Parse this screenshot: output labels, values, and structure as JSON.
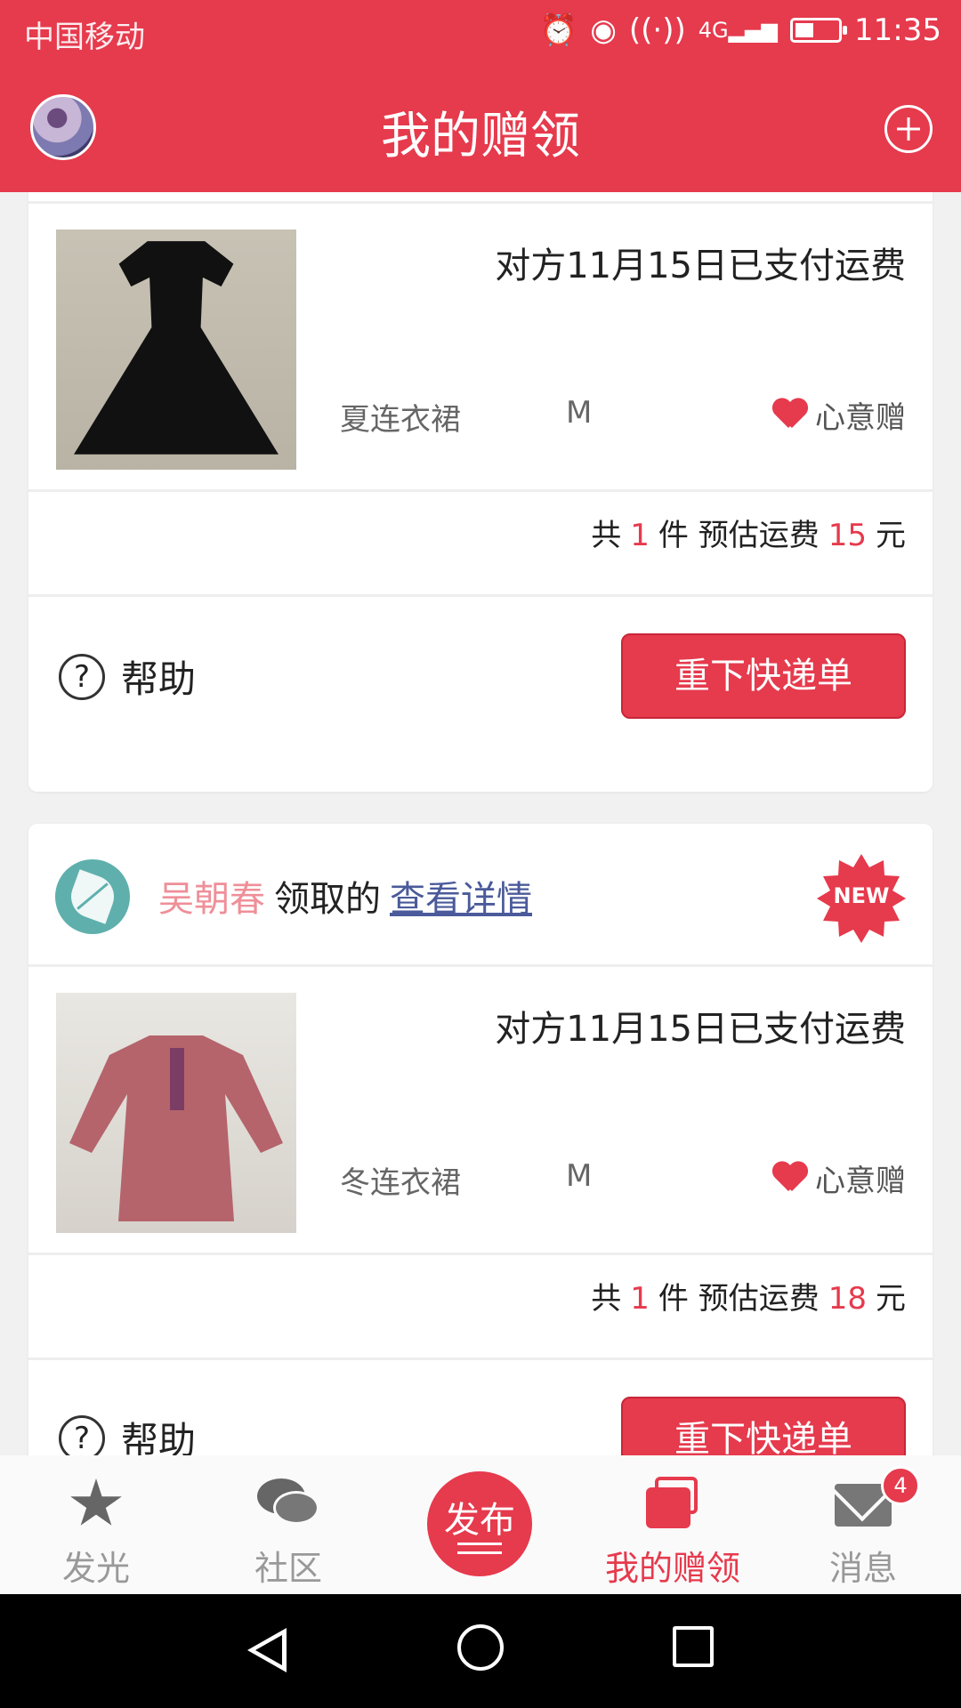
{
  "status_bar": {
    "carrier": "中国移动",
    "time": "11:35",
    "network": "4G"
  },
  "header": {
    "title": "我的赠领"
  },
  "cards": [
    {
      "paid_text": "对方11月15日已支付运费",
      "item_name": "夏连衣裙",
      "size": "M",
      "gift_type": "心意赠",
      "summary": {
        "prefix": "共",
        "count": "1",
        "unit": "件 预估运费",
        "fee": "15",
        "currency": "元"
      },
      "help_label": "帮助",
      "action_label": "重下快递单"
    },
    {
      "user": "吴朝春",
      "action": "领取的",
      "details_link": "查看详情",
      "badge": "NEW",
      "paid_text": "对方11月15日已支付运费",
      "item_name": "冬连衣裙",
      "size": "M",
      "gift_type": "心意赠",
      "summary": {
        "prefix": "共",
        "count": "1",
        "unit": "件 预估运费",
        "fee": "18",
        "currency": "元"
      },
      "help_label": "帮助",
      "action_label": "重下快递单"
    }
  ],
  "tabbar": {
    "tabs": [
      {
        "label": "发光",
        "icon": "star-icon"
      },
      {
        "label": "社区",
        "icon": "chat-icon"
      },
      {
        "label": "发布",
        "icon": "publish-icon"
      },
      {
        "label": "我的赠领",
        "icon": "cards-icon",
        "active": true
      },
      {
        "label": "消息",
        "icon": "mail-icon",
        "badge": "4"
      }
    ]
  },
  "colors": {
    "accent": "#e63a4d",
    "username": "#ef8f98",
    "link": "#4a5a9a"
  }
}
